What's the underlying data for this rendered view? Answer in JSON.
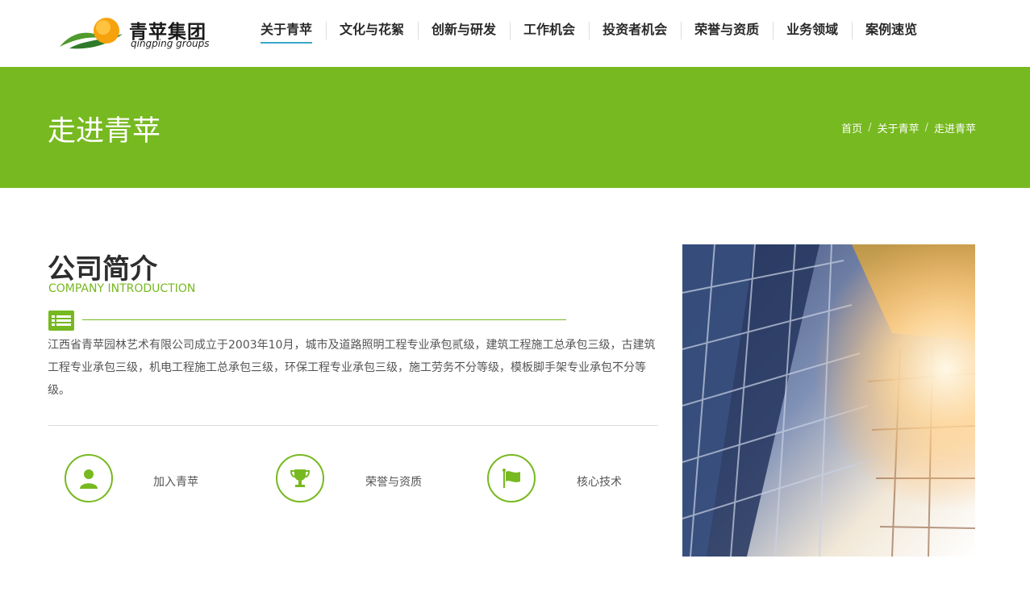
{
  "header": {
    "logo_text": "青苹集团",
    "logo_sub": "qingping groups",
    "nav": [
      "关于青苹",
      "文化与花絮",
      "创新与研发",
      "工作机会",
      "投资者机会",
      "荣誉与资质",
      "业务领域",
      "案例速览"
    ]
  },
  "banner": {
    "title": "走进青苹",
    "breadcrumb": [
      "首页",
      "关于青苹",
      "走进青苹"
    ],
    "separator": "/"
  },
  "intro": {
    "title": "公司简介",
    "subtitle": "COMPANY INTRODUCTION",
    "text": "江西省青苹园林艺术有限公司成立于2003年10月，城市及道路照明工程专业承包贰级，建筑工程施工总承包三级，古建筑工程专业承包三级，机电工程施工总承包三级，环保工程专业承包三级，施工劳务不分等级，模板脚手架专业承包不分等级。"
  },
  "links": [
    {
      "label": "加入青苹",
      "icon": "user-icon"
    },
    {
      "label": "荣誉与资质",
      "icon": "trophy-icon"
    },
    {
      "label": "核心技术",
      "icon": "flag-icon"
    }
  ],
  "colors": {
    "accent": "#77b920",
    "nav_active_underline": "#3aa7c9"
  }
}
